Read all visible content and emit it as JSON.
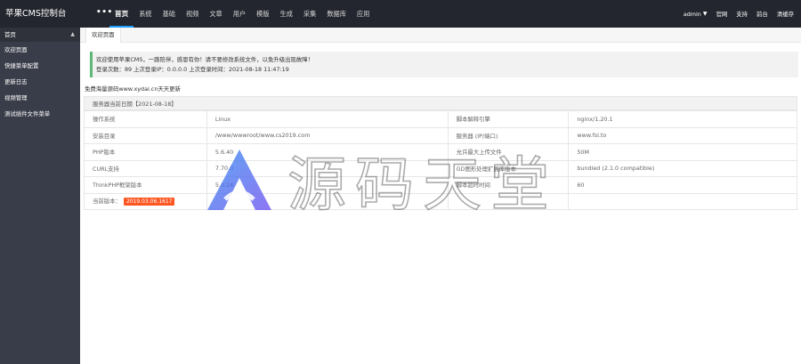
{
  "app": {
    "brand": "苹果CMS控制台",
    "more": "•••"
  },
  "nav": [
    {
      "label": "首页",
      "active": true
    },
    {
      "label": "系统"
    },
    {
      "label": "基础"
    },
    {
      "label": "视频"
    },
    {
      "label": "文章"
    },
    {
      "label": "用户"
    },
    {
      "label": "模版"
    },
    {
      "label": "生成"
    },
    {
      "label": "采集"
    },
    {
      "label": "数据库"
    },
    {
      "label": "应用"
    }
  ],
  "right_menu": {
    "user": "admin",
    "site": "官网",
    "support": "支持",
    "home": "前台",
    "clear": "清缓存"
  },
  "sidebar": {
    "header": "首页",
    "items": [
      {
        "label": "欢迎页面"
      },
      {
        "label": "快捷菜单配置"
      },
      {
        "label": "更新日志"
      },
      {
        "label": "视频管理"
      },
      {
        "label": "测试插件文件菜单"
      }
    ]
  },
  "tabs": [
    {
      "label": "欢迎页面"
    }
  ],
  "welcome": {
    "line1": "欢迎使用苹果CMS，一路陪伴，感恩有你！请不要修改系统文件，以免升级出现故障！",
    "line2": "登录次数：89 上次登录IP：0.0.0.0 上次登录时间：2021-08-18 11:47:19"
  },
  "notice": "免费海量源码www.xydai.cn天天更新",
  "server": {
    "title": "服务器当前日期【2021-08-18】",
    "rows": [
      [
        "操作系统",
        "Linux",
        "脚本解释引擎",
        "nginx/1.20.1"
      ],
      [
        "安装目录",
        "/www/wwwroot/www.cs2019.com",
        "服务器 (IP/端口)",
        "www.fsl.to"
      ],
      [
        "PHP版本",
        "5.6.40",
        "允许最大上传文件",
        "50M"
      ],
      [
        "CURL支持",
        "7.70.0",
        "GD图形处理扩展库版本",
        "bundled (2.1.0 compatible)"
      ],
      [
        "ThinkPHP框架版本",
        "5.0.24",
        "脚本超时时间",
        "60"
      ]
    ],
    "version_label": "当前版本：",
    "version": "2019.03.06.1617"
  },
  "watermark": {
    "text": "源码天堂"
  },
  "colors": {
    "topbar": "#23262e",
    "sidebar": "#393d49",
    "accent": "#5fb878",
    "badge": "#ff5722",
    "watermark": "#2f8cf0"
  }
}
